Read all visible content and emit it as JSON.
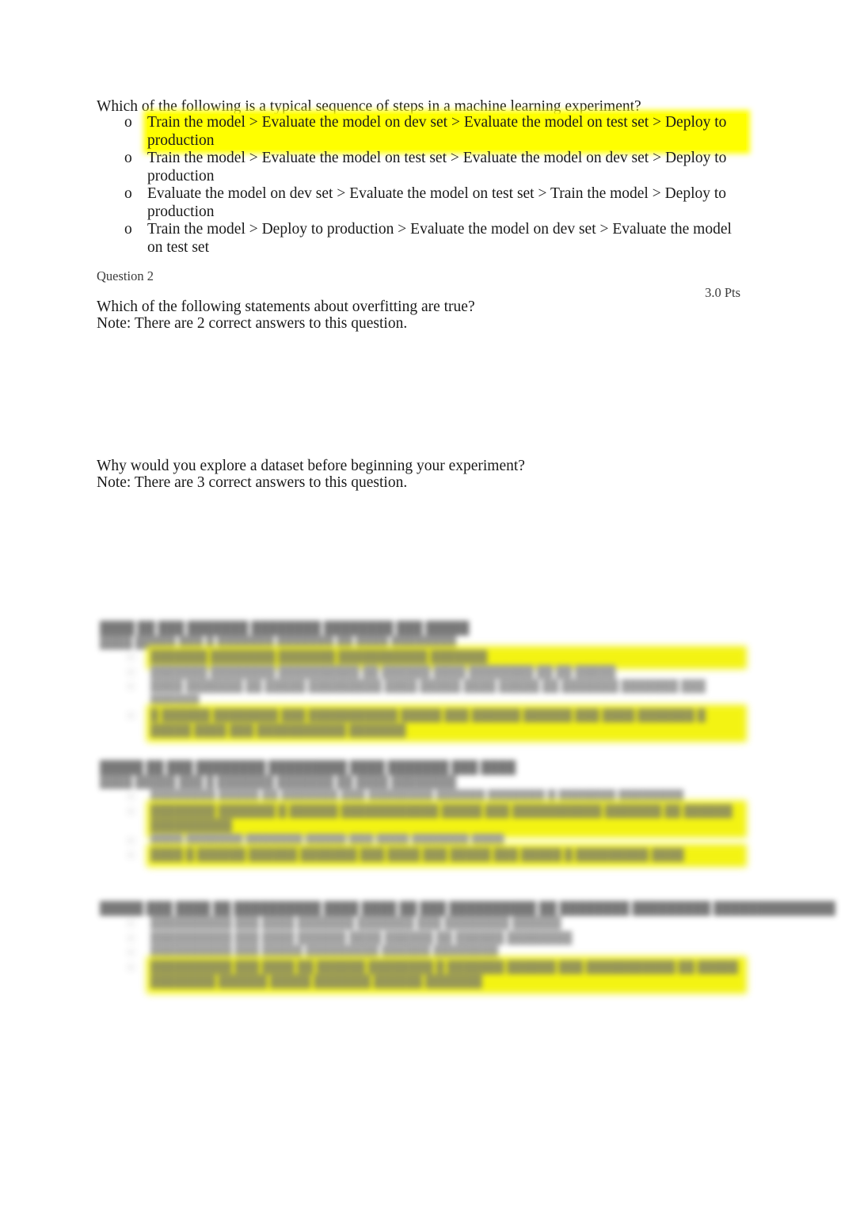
{
  "document": {
    "page_background": "#ffffff",
    "highlight_color": "#ffff00",
    "text_color": "#1a1a1a"
  },
  "question_1": {
    "stem": "Which of the following is a typical sequence of steps in a machine learning experiment?",
    "marker": "o",
    "options": [
      {
        "marker": "o",
        "text": "Train the model > Evaluate the model on dev set > Evaluate the model on test set > Deploy to production",
        "highlighted": true
      },
      {
        "marker": "o",
        "text": "Train the model > Evaluate the model on test set > Evaluate the model on dev set > Deploy to production",
        "highlighted": false
      },
      {
        "marker": "o",
        "text": "Evaluate the model on dev set > Evaluate the model on test set > Train the model > Deploy to production",
        "highlighted": false
      },
      {
        "marker": "o",
        "text": "Train the model > Deploy to production > Evaluate the model on dev set > Evaluate the model on test set",
        "highlighted": false
      }
    ]
  },
  "question_2": {
    "label": "Question 2",
    "points": "3.0 Pts",
    "stem": "Which of the following statements about overfitting are true?",
    "note": "Note: There are 2 correct answers to this question."
  },
  "question_3": {
    "stem": "Why would you explore a dataset before beginning your experiment?",
    "note": "Note: There are 3 correct answers to this question."
  },
  "redacted_sections": [
    {
      "id": "redacted-question-a",
      "stem": "████ ██ ███ ███████ ████████ ████████ ███ █████",
      "note": "████ █████ ███ █ ███████ ███████ ██ ████ ████████",
      "options": [
        {
          "marker": "□",
          "text": "███████ ████████ ███████ ███████████ ███████",
          "highlighted": true
        },
        {
          "marker": "□",
          "text": "███████ ████████ ██████████ ██ ██████ ████ ████████ ██ ██ █████",
          "highlighted": false
        },
        {
          "marker": "□",
          "text": "████ ███████ ██ █████ █████████ ████ █████ ████ █████ ██ ███████ ███████ ███ ██████",
          "highlighted": false
        },
        {
          "marker": "□",
          "text": "█ ██████ ████████ ███ ███████████ █████ ███ ██████ ██████ ███ ████ ███████ █ █████ ████ ███ ███████████ ███████",
          "highlighted": true
        }
      ]
    },
    {
      "id": "redacted-question-b",
      "stem": "█████ ██ ███ ████████ █████████ ████ ███████ ███ ████",
      "note": "████ █████ ███ █ ███████ ███████ ██ ████ ████████",
      "options": [
        {
          "marker": "□",
          "text": "████████ █████ ██ ███████ ███ ████████ ██████ ███████ █ ███████ ████████",
          "highlighted": false
        },
        {
          "marker": "□",
          "text": "████████ ███████ █ ██████ ████████████ █████ ███ ███████████ ███████ ██ ██████ ██████████",
          "highlighted": true
        },
        {
          "marker": "□",
          "text": "████ ███████ ███████ █████ ███ ████ ███████ ████",
          "highlighted": false
        },
        {
          "marker": "□",
          "text": "████ █ ██████ ██████ ███████ ███ ████ ███ █████ ███ █████ █ █████████ ████",
          "highlighted": true
        }
      ]
    },
    {
      "id": "redacted-question-c",
      "stem": "█████ ███ ████ ██ ██████████ ████ ████ ██ ███ ██████████ ██ ████████ █████████ ██████████████",
      "note": "",
      "options": [
        {
          "marker": "□",
          "text": "██████████ ███ ████ ███████ ███████ ███ ████████ ██████",
          "highlighted": false
        },
        {
          "marker": "□",
          "text": "██████████ ███ ████ ██████ ████ ██████ ██ ██████ ████████",
          "highlighted": false
        },
        {
          "marker": "□",
          "text": "██████████ ███ █████ █████████ ██████ ████████",
          "highlighted": false
        },
        {
          "marker": "□",
          "text": "██████████ ███ ████ ██ ██████ ████████ █ ███████ ██████ ███ ███████████ ██ █████ ████████ ██████ █████ ███████ ██████ ███████",
          "highlighted": true
        }
      ]
    }
  ]
}
